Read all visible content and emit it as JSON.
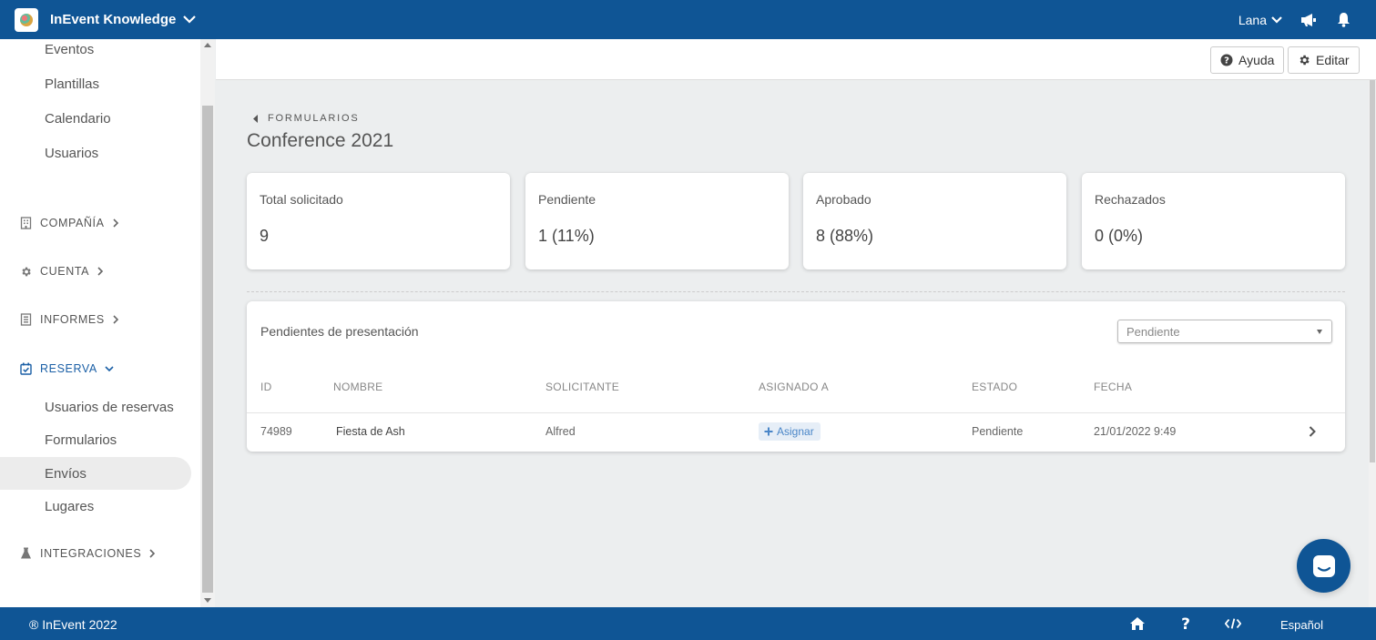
{
  "topbar": {
    "app_name": "InEvent Knowledge",
    "user_name": "Lana"
  },
  "sidebar": {
    "items_top": [
      "Eventos",
      "Plantillas",
      "Calendario",
      "Usuarios"
    ],
    "sections": {
      "company": "COMPAÑÍA",
      "account": "CUENTA",
      "reports": "INFORMES",
      "booking": "RESERVA",
      "integrations": "INTEGRACIONES"
    },
    "booking_items": [
      "Usuarios de reservas",
      "Formularios",
      "Envíos",
      "Lugares"
    ],
    "active_item": "Envíos"
  },
  "header": {
    "help_label": "Ayuda",
    "edit_label": "Editar"
  },
  "page": {
    "breadcrumb": "FORMULARIOS",
    "title": "Conference 2021"
  },
  "stats": [
    {
      "label": "Total solicitado",
      "value": "9"
    },
    {
      "label": "Pendiente",
      "value": "1 (11%)"
    },
    {
      "label": "Aprobado",
      "value": "8 (88%)"
    },
    {
      "label": "Rechazados",
      "value": "0 (0%)"
    }
  ],
  "submissions": {
    "title": "Pendientes de presentación",
    "filter_value": "Pendiente",
    "columns": [
      "ID",
      "NOMBRE",
      "SOLICITANTE",
      "ASIGNADO A",
      "ESTADO",
      "FECHA"
    ],
    "rows": [
      {
        "id": "74989",
        "name": "Fiesta de Ash",
        "requester": "Alfred",
        "assign_label": "Asignar",
        "status": "Pendiente",
        "date": "21/01/2022 9:49"
      }
    ]
  },
  "footer": {
    "copyright": "® InEvent 2022",
    "language": "Español"
  },
  "colors": {
    "brand": "#0f5595",
    "active_section": "#1a5fa6",
    "background": "#eceeef"
  }
}
